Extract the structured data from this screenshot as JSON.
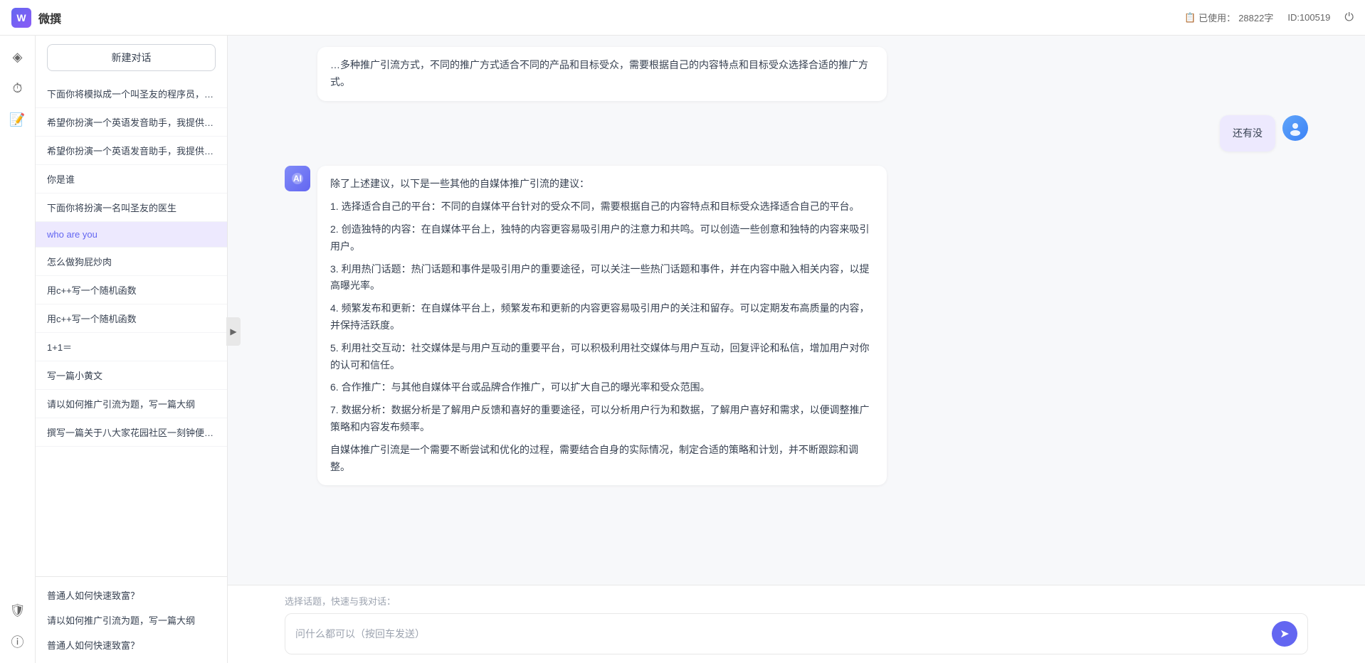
{
  "header": {
    "logo_text": "W",
    "title": "微撰",
    "usage_label": "已使用：",
    "usage_count": "28822字",
    "id_label": "ID:100519",
    "power_icon": "⏻"
  },
  "sidebar": {
    "new_conversation": "新建对话",
    "items": [
      {
        "id": 1,
        "label": "下面你将模拟成一个叫圣友的程序员，我说..."
      },
      {
        "id": 2,
        "label": "希望你扮演一个英语发音助手，我提供给你..."
      },
      {
        "id": 3,
        "label": "希望你扮演一个英语发音助手，我提供给你..."
      },
      {
        "id": 4,
        "label": "你是谁"
      },
      {
        "id": 5,
        "label": "下面你将扮演一名叫圣友的医生"
      },
      {
        "id": 6,
        "label": "who are you",
        "active": true
      },
      {
        "id": 7,
        "label": "怎么做狗屁炒肉"
      },
      {
        "id": 8,
        "label": "用c++写一个随机函数"
      },
      {
        "id": 9,
        "label": "用c++写一个随机函数"
      },
      {
        "id": 10,
        "label": "1+1＝"
      },
      {
        "id": 11,
        "label": "写一篇小黄文"
      },
      {
        "id": 12,
        "label": "请以如何推广引流为题，写一篇大纲"
      },
      {
        "id": 13,
        "label": "撰写一篇关于八大家花园社区一刻钟便民生..."
      }
    ],
    "bottom_items": [
      {
        "id": 1,
        "label": "普通人如何快速致富？"
      },
      {
        "id": 2,
        "label": "请以如何推广引流为题，写一篇大纲"
      },
      {
        "id": 3,
        "label": "普通人如何快速致富？"
      }
    ]
  },
  "icon_bar": {
    "icons": [
      {
        "id": "diamond",
        "symbol": "◈",
        "active": false
      },
      {
        "id": "clock",
        "symbol": "⏱",
        "active": false
      },
      {
        "id": "document",
        "symbol": "📄",
        "active": false
      }
    ],
    "bottom_icons": [
      {
        "id": "shield",
        "symbol": "🛡",
        "active": false
      },
      {
        "id": "info",
        "symbol": "ℹ",
        "active": false
      }
    ]
  },
  "chat": {
    "partial_top": "…多种推广引流方式，不同的推广方式适合不同的产品和目标受众，需要根据自己的内容特点和目标受众选择合适的推广方式。",
    "messages": [
      {
        "id": 1,
        "role": "user",
        "text": "还有没"
      },
      {
        "id": 2,
        "role": "ai",
        "paragraphs": [
          "除了上述建议，以下是一些其他的自媒体推广引流的建议：",
          "1. 选择适合自己的平台：不同的自媒体平台针对的受众不同，需要根据自己的内容特点和目标受众选择适合自己的平台。",
          "2. 创造独特的内容：在自媒体平台上，独特的内容更容易吸引用户的注意力和共鸣。可以创造一些创意和独特的内容来吸引用户。",
          "3. 利用热门话题：热门话题和事件是吸引用户的重要途径，可以关注一些热门话题和事件，并在内容中融入相关内容，以提高曝光率。",
          "4. 频繁发布和更新：在自媒体平台上，频繁发布和更新的内容更容易吸引用户的关注和留存。可以定期发布高质量的内容，并保持活跃度。",
          "5. 利用社交互动：社交媒体是与用户互动的重要平台，可以积极利用社交媒体与用户互动，回复评论和私信，增加用户对你的认可和信任。",
          "6. 合作推广：与其他自媒体平台或品牌合作推广，可以扩大自己的曝光率和受众范围。",
          "7. 数据分析：数据分析是了解用户反馈和喜好的重要途径，可以分析用户行为和数据，了解用户喜好和需求，以便调整推广策略和内容发布频率。",
          "自媒体推广引流是一个需要不断尝试和优化的过程，需要结合自身的实际情况，制定合适的策略和计划，并不断跟踪和调整。"
        ]
      }
    ],
    "input_placeholder": "问什么都可以（按回车发送）",
    "quick_topics_label": "选择话题，快速与我对话：",
    "send_icon": "➤"
  }
}
